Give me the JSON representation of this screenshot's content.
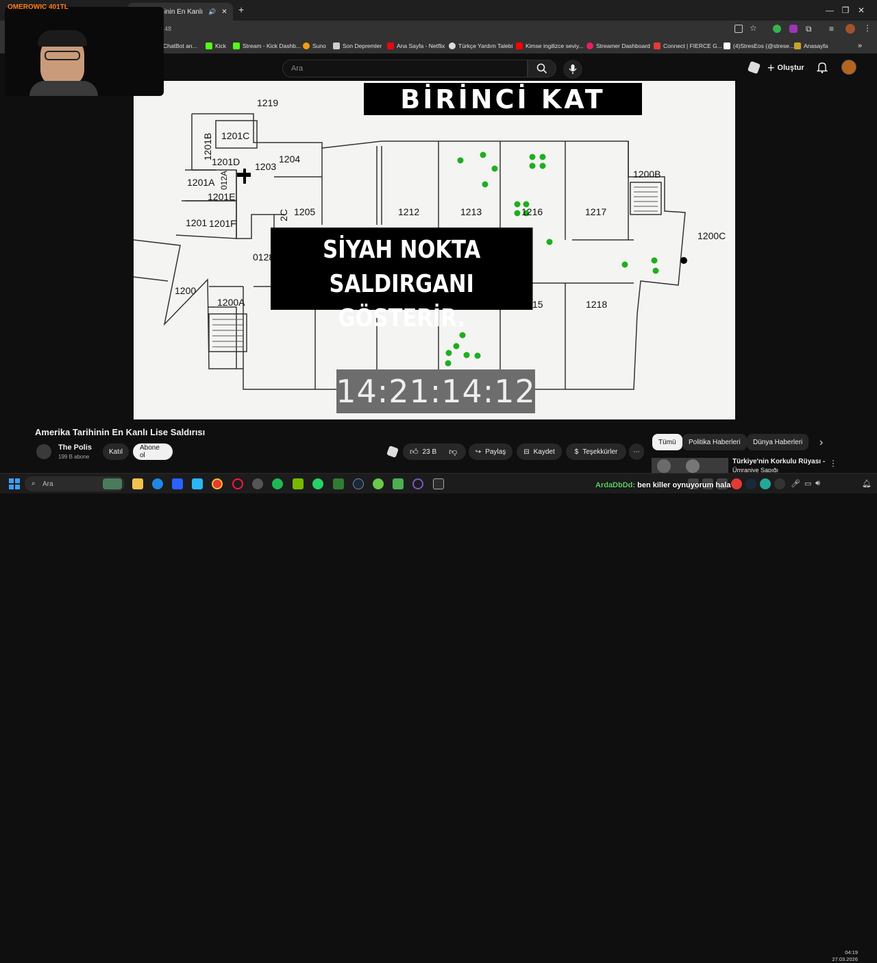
{
  "streamer": {
    "label": "OMEROWIC 401TL"
  },
  "browser": {
    "active_tab_title": "a Tarihinin En Kanlı L",
    "address_fragment": "48",
    "bookmarks": [
      {
        "label": "ChatBot an...",
        "color": "#888888"
      },
      {
        "label": "Kick",
        "color": "#53fc18"
      },
      {
        "label": "Stream - Kick Dashb...",
        "color": "#53fc18"
      },
      {
        "label": "Suno",
        "color": "#f39c12"
      },
      {
        "label": "Son Depremler",
        "color": "#cccccc"
      },
      {
        "label": "Ana Sayfa - Netflix",
        "color": "#e50914"
      },
      {
        "label": "Türkçe Yardım Talebi",
        "color": "#dddddd"
      },
      {
        "label": "Kimse ingilizce seviy...",
        "color": "#ff0000"
      },
      {
        "label": "Streamer Dashboard",
        "color": "#e91e63"
      },
      {
        "label": "Connect | FIERCE G...",
        "color": "#e53935"
      },
      {
        "label": "(4)StresEos (@strese...",
        "color": "#ffffff"
      },
      {
        "label": "Anasayfa",
        "color": "#c9a227"
      }
    ]
  },
  "youtube": {
    "search_placeholder": "Ara",
    "create_label": "Oluştur"
  },
  "video": {
    "banner": "BİRİNCİ KAT",
    "caption_line1": "SİYAH NOKTA SALDIRGANI",
    "caption_line2": "GÖSTERİR.",
    "timecode": "14:21:14:12",
    "rooms": [
      "1219",
      "1201C",
      "1201B",
      "1204",
      "1201D",
      "1203",
      "012A",
      "1201A",
      "1201E",
      "1205",
      "2C",
      "1212",
      "1213",
      "1216",
      "1217",
      "1200B",
      "1201",
      "1201F",
      "0128",
      "1200C",
      "1200",
      "1200A",
      "15",
      "1218"
    ]
  },
  "details": {
    "title": "Amerika Tarihinin En Kanlı Lise Saldırısı",
    "channel": "The Polis",
    "subscribers": "199 B abone",
    "join_label": "Katıl",
    "subscribe_label": "Abone ol",
    "likes": "23 B",
    "share_label": "Paylaş",
    "save_label": "Kaydet",
    "thanks_label": "Teşekkürler"
  },
  "chips": [
    "Tümü",
    "Politika Haberleri",
    "Dünya Haberleri"
  ],
  "recommended": {
    "title": "Türkiye'nin Korkulu Rüyası -",
    "subtitle": "Ümraniye Sapığı"
  },
  "taskbar": {
    "search_placeholder": "Ara",
    "time": "04:19",
    "date": "27.03.2026"
  },
  "chat_overlay": {
    "user": "ArdaDbDd:",
    "message": " ben killer oynuyorum hala"
  },
  "colors": {
    "accent": "#ff0000",
    "page_bg": "#0f0f0f",
    "dot_green": "#1fae1f"
  }
}
